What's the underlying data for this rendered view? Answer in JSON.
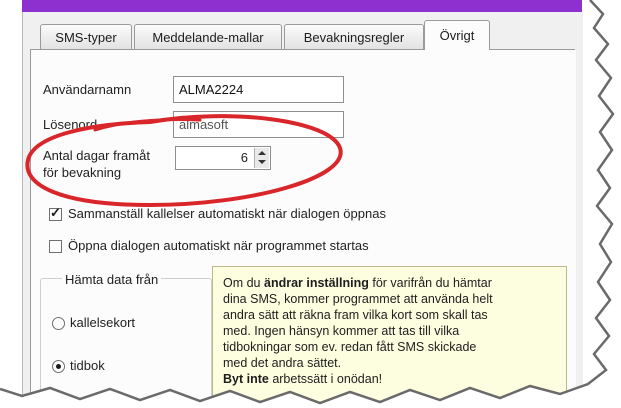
{
  "tabs": [
    {
      "label": "SMS-typer",
      "active": false
    },
    {
      "label": "Meddelande-mallar",
      "active": false
    },
    {
      "label": "Bevakningsregler",
      "active": false
    },
    {
      "label": "Övrigt",
      "active": true
    }
  ],
  "form": {
    "username_label": "Användarnamn",
    "username_value": "ALMA2224",
    "password_label": "Lösenord",
    "password_value": "almasoft",
    "days_label_line1": "Antal dagar framåt",
    "days_label_line2": "för bevakning",
    "days_value": "6",
    "auto_compile_label": "Sammanställ kallelser automatiskt när dialogen öppnas",
    "auto_compile_checked": true,
    "open_on_start_label": "Öppna dialogen automatiskt när programmet startas",
    "open_on_start_checked": false
  },
  "fetch_group": {
    "title": "Hämta data från",
    "options": [
      {
        "label": "kallelsekort",
        "selected": false
      },
      {
        "label": "tidbok",
        "selected": true
      }
    ]
  },
  "tooltip": {
    "line1_pre": "Om du ",
    "line1_bold": "ändrar inställning",
    "line1_post": " för varifrån du hämtar",
    "line2": "dina SMS, kommer programmet att använda helt",
    "line3": "andra sätt att räkna fram vilka kort som skall tas",
    "line4": "med. Ingen hänsyn kommer att tas till vilka",
    "line5": "tidbokningar som ev. redan fått SMS skickade",
    "line6": "med det andra sättet.",
    "line7_bold": "Byt inte",
    "line7_post": " arbetssätt i onödan!"
  },
  "colors": {
    "titlebar": "#8e2fd0",
    "annotation": "#d9262a",
    "tooltip_bg": "#fdfde0"
  }
}
